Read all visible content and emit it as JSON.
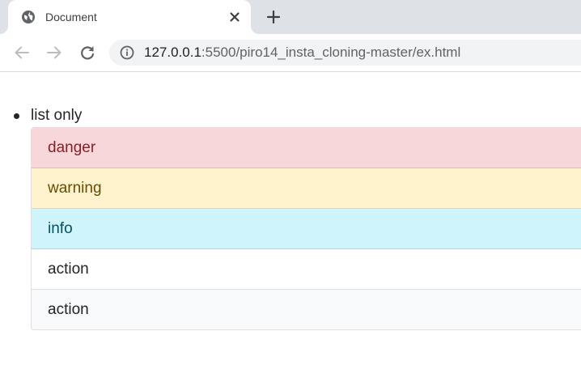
{
  "browser": {
    "tab": {
      "title": "Document",
      "favicon": "globe-icon",
      "close_icon": "close-icon"
    },
    "new_tab_icon": "plus-icon",
    "toolbar": {
      "back_icon": "arrow-left-icon",
      "forward_icon": "arrow-right-icon",
      "reload_icon": "reload-icon",
      "info_icon": "info-icon"
    },
    "address": {
      "host": "127.0.0.1",
      "rest": ":5500/piro14_insta_cloning-master/ex.html"
    }
  },
  "page": {
    "list_label": "list only",
    "items": [
      {
        "label": "danger",
        "variant": "danger"
      },
      {
        "label": "warning",
        "variant": "warning"
      },
      {
        "label": "info",
        "variant": "info"
      },
      {
        "label": "action",
        "variant": "action"
      },
      {
        "label": "action",
        "variant": "action"
      }
    ]
  },
  "colors": {
    "danger_bg": "#f8d7da",
    "warning_bg": "#fff3cd",
    "info_bg": "#cff4fc",
    "tabstrip_bg": "#dee1e6",
    "omnibox_bg": "#f1f3f4"
  }
}
